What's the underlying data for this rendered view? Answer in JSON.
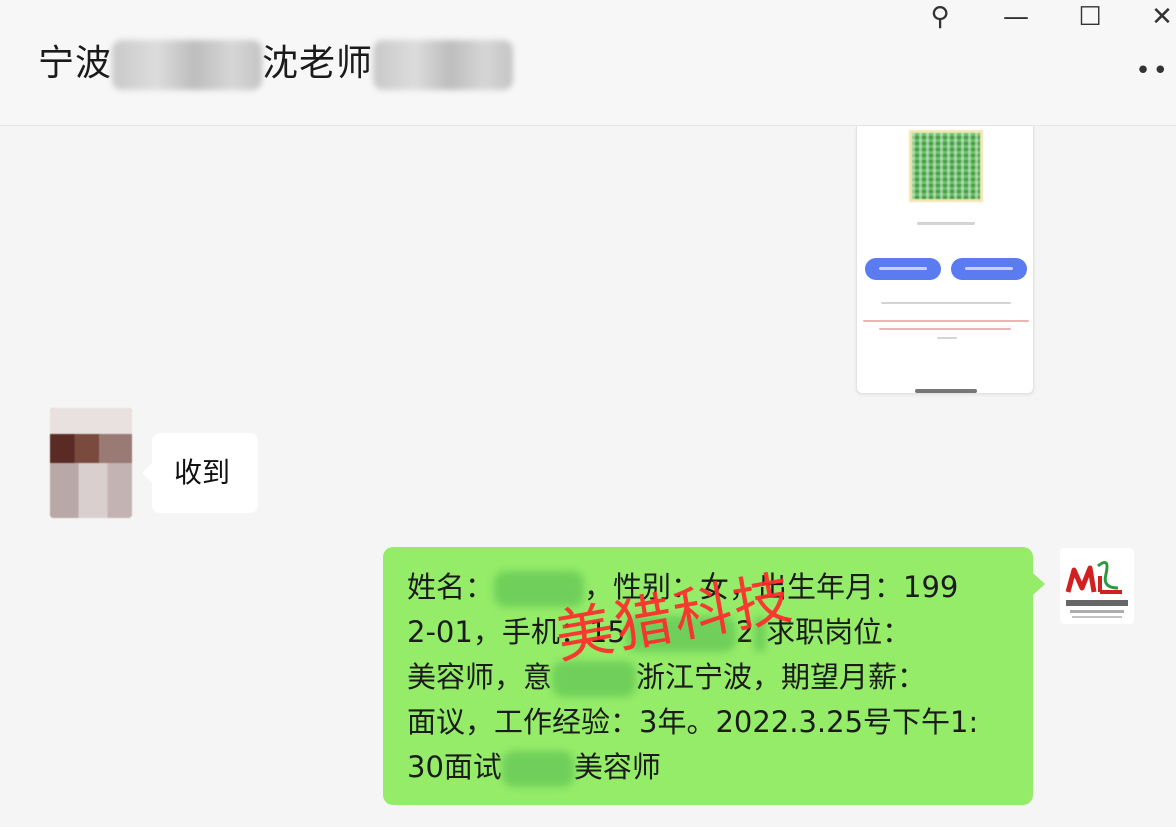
{
  "window": {
    "title_prefix": "宁波",
    "title_middle": "沈老师",
    "title_suffix": "",
    "controls": {
      "pin": "⚲",
      "minimize": "—",
      "maximize": "☐",
      "close": "✕",
      "more": "••"
    }
  },
  "messages": [
    {
      "side": "right",
      "type": "image",
      "description_icon": "phone-screenshot"
    },
    {
      "side": "left",
      "type": "text",
      "text": "收到"
    },
    {
      "side": "right",
      "type": "text",
      "lines": [
        {
          "before": "姓名：",
          "after": "，性别：女，出生年月：199"
        },
        {
          "before": "2-01，手机：15",
          "after": "2",
          "tail": "求职岗位："
        },
        {
          "before": "美容师，意",
          "after": "浙江宁波，期望月薪："
        },
        {
          "before": "面议，工作经验：3年。2022.3.25号下午1:"
        },
        {
          "before": "30面试",
          "after": "美容师"
        }
      ]
    }
  ],
  "watermark": "美猎科技",
  "colors": {
    "self_bubble": "#95ec69",
    "other_bubble": "#ffffff",
    "watermark": "#ff2b2b",
    "background": "#f5f5f5"
  }
}
